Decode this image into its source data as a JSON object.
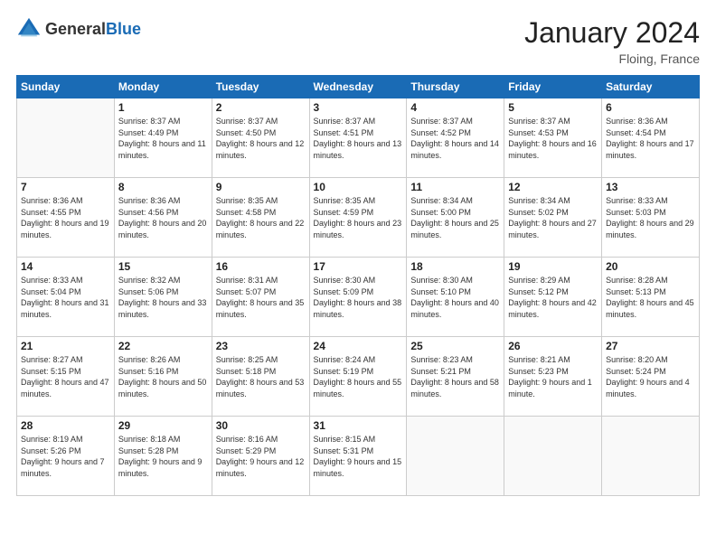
{
  "header": {
    "logo_general": "General",
    "logo_blue": "Blue",
    "title": "January 2024",
    "location": "Floing, France"
  },
  "weekdays": [
    "Sunday",
    "Monday",
    "Tuesday",
    "Wednesday",
    "Thursday",
    "Friday",
    "Saturday"
  ],
  "weeks": [
    [
      {
        "day": "",
        "sunrise": "",
        "sunset": "",
        "daylight": ""
      },
      {
        "day": "1",
        "sunrise": "Sunrise: 8:37 AM",
        "sunset": "Sunset: 4:49 PM",
        "daylight": "Daylight: 8 hours and 11 minutes."
      },
      {
        "day": "2",
        "sunrise": "Sunrise: 8:37 AM",
        "sunset": "Sunset: 4:50 PM",
        "daylight": "Daylight: 8 hours and 12 minutes."
      },
      {
        "day": "3",
        "sunrise": "Sunrise: 8:37 AM",
        "sunset": "Sunset: 4:51 PM",
        "daylight": "Daylight: 8 hours and 13 minutes."
      },
      {
        "day": "4",
        "sunrise": "Sunrise: 8:37 AM",
        "sunset": "Sunset: 4:52 PM",
        "daylight": "Daylight: 8 hours and 14 minutes."
      },
      {
        "day": "5",
        "sunrise": "Sunrise: 8:37 AM",
        "sunset": "Sunset: 4:53 PM",
        "daylight": "Daylight: 8 hours and 16 minutes."
      },
      {
        "day": "6",
        "sunrise": "Sunrise: 8:36 AM",
        "sunset": "Sunset: 4:54 PM",
        "daylight": "Daylight: 8 hours and 17 minutes."
      }
    ],
    [
      {
        "day": "7",
        "sunrise": "Sunrise: 8:36 AM",
        "sunset": "Sunset: 4:55 PM",
        "daylight": "Daylight: 8 hours and 19 minutes."
      },
      {
        "day": "8",
        "sunrise": "Sunrise: 8:36 AM",
        "sunset": "Sunset: 4:56 PM",
        "daylight": "Daylight: 8 hours and 20 minutes."
      },
      {
        "day": "9",
        "sunrise": "Sunrise: 8:35 AM",
        "sunset": "Sunset: 4:58 PM",
        "daylight": "Daylight: 8 hours and 22 minutes."
      },
      {
        "day": "10",
        "sunrise": "Sunrise: 8:35 AM",
        "sunset": "Sunset: 4:59 PM",
        "daylight": "Daylight: 8 hours and 23 minutes."
      },
      {
        "day": "11",
        "sunrise": "Sunrise: 8:34 AM",
        "sunset": "Sunset: 5:00 PM",
        "daylight": "Daylight: 8 hours and 25 minutes."
      },
      {
        "day": "12",
        "sunrise": "Sunrise: 8:34 AM",
        "sunset": "Sunset: 5:02 PM",
        "daylight": "Daylight: 8 hours and 27 minutes."
      },
      {
        "day": "13",
        "sunrise": "Sunrise: 8:33 AM",
        "sunset": "Sunset: 5:03 PM",
        "daylight": "Daylight: 8 hours and 29 minutes."
      }
    ],
    [
      {
        "day": "14",
        "sunrise": "Sunrise: 8:33 AM",
        "sunset": "Sunset: 5:04 PM",
        "daylight": "Daylight: 8 hours and 31 minutes."
      },
      {
        "day": "15",
        "sunrise": "Sunrise: 8:32 AM",
        "sunset": "Sunset: 5:06 PM",
        "daylight": "Daylight: 8 hours and 33 minutes."
      },
      {
        "day": "16",
        "sunrise": "Sunrise: 8:31 AM",
        "sunset": "Sunset: 5:07 PM",
        "daylight": "Daylight: 8 hours and 35 minutes."
      },
      {
        "day": "17",
        "sunrise": "Sunrise: 8:30 AM",
        "sunset": "Sunset: 5:09 PM",
        "daylight": "Daylight: 8 hours and 38 minutes."
      },
      {
        "day": "18",
        "sunrise": "Sunrise: 8:30 AM",
        "sunset": "Sunset: 5:10 PM",
        "daylight": "Daylight: 8 hours and 40 minutes."
      },
      {
        "day": "19",
        "sunrise": "Sunrise: 8:29 AM",
        "sunset": "Sunset: 5:12 PM",
        "daylight": "Daylight: 8 hours and 42 minutes."
      },
      {
        "day": "20",
        "sunrise": "Sunrise: 8:28 AM",
        "sunset": "Sunset: 5:13 PM",
        "daylight": "Daylight: 8 hours and 45 minutes."
      }
    ],
    [
      {
        "day": "21",
        "sunrise": "Sunrise: 8:27 AM",
        "sunset": "Sunset: 5:15 PM",
        "daylight": "Daylight: 8 hours and 47 minutes."
      },
      {
        "day": "22",
        "sunrise": "Sunrise: 8:26 AM",
        "sunset": "Sunset: 5:16 PM",
        "daylight": "Daylight: 8 hours and 50 minutes."
      },
      {
        "day": "23",
        "sunrise": "Sunrise: 8:25 AM",
        "sunset": "Sunset: 5:18 PM",
        "daylight": "Daylight: 8 hours and 53 minutes."
      },
      {
        "day": "24",
        "sunrise": "Sunrise: 8:24 AM",
        "sunset": "Sunset: 5:19 PM",
        "daylight": "Daylight: 8 hours and 55 minutes."
      },
      {
        "day": "25",
        "sunrise": "Sunrise: 8:23 AM",
        "sunset": "Sunset: 5:21 PM",
        "daylight": "Daylight: 8 hours and 58 minutes."
      },
      {
        "day": "26",
        "sunrise": "Sunrise: 8:21 AM",
        "sunset": "Sunset: 5:23 PM",
        "daylight": "Daylight: 9 hours and 1 minute."
      },
      {
        "day": "27",
        "sunrise": "Sunrise: 8:20 AM",
        "sunset": "Sunset: 5:24 PM",
        "daylight": "Daylight: 9 hours and 4 minutes."
      }
    ],
    [
      {
        "day": "28",
        "sunrise": "Sunrise: 8:19 AM",
        "sunset": "Sunset: 5:26 PM",
        "daylight": "Daylight: 9 hours and 7 minutes."
      },
      {
        "day": "29",
        "sunrise": "Sunrise: 8:18 AM",
        "sunset": "Sunset: 5:28 PM",
        "daylight": "Daylight: 9 hours and 9 minutes."
      },
      {
        "day": "30",
        "sunrise": "Sunrise: 8:16 AM",
        "sunset": "Sunset: 5:29 PM",
        "daylight": "Daylight: 9 hours and 12 minutes."
      },
      {
        "day": "31",
        "sunrise": "Sunrise: 8:15 AM",
        "sunset": "Sunset: 5:31 PM",
        "daylight": "Daylight: 9 hours and 15 minutes."
      },
      {
        "day": "",
        "sunrise": "",
        "sunset": "",
        "daylight": ""
      },
      {
        "day": "",
        "sunrise": "",
        "sunset": "",
        "daylight": ""
      },
      {
        "day": "",
        "sunrise": "",
        "sunset": "",
        "daylight": ""
      }
    ]
  ]
}
